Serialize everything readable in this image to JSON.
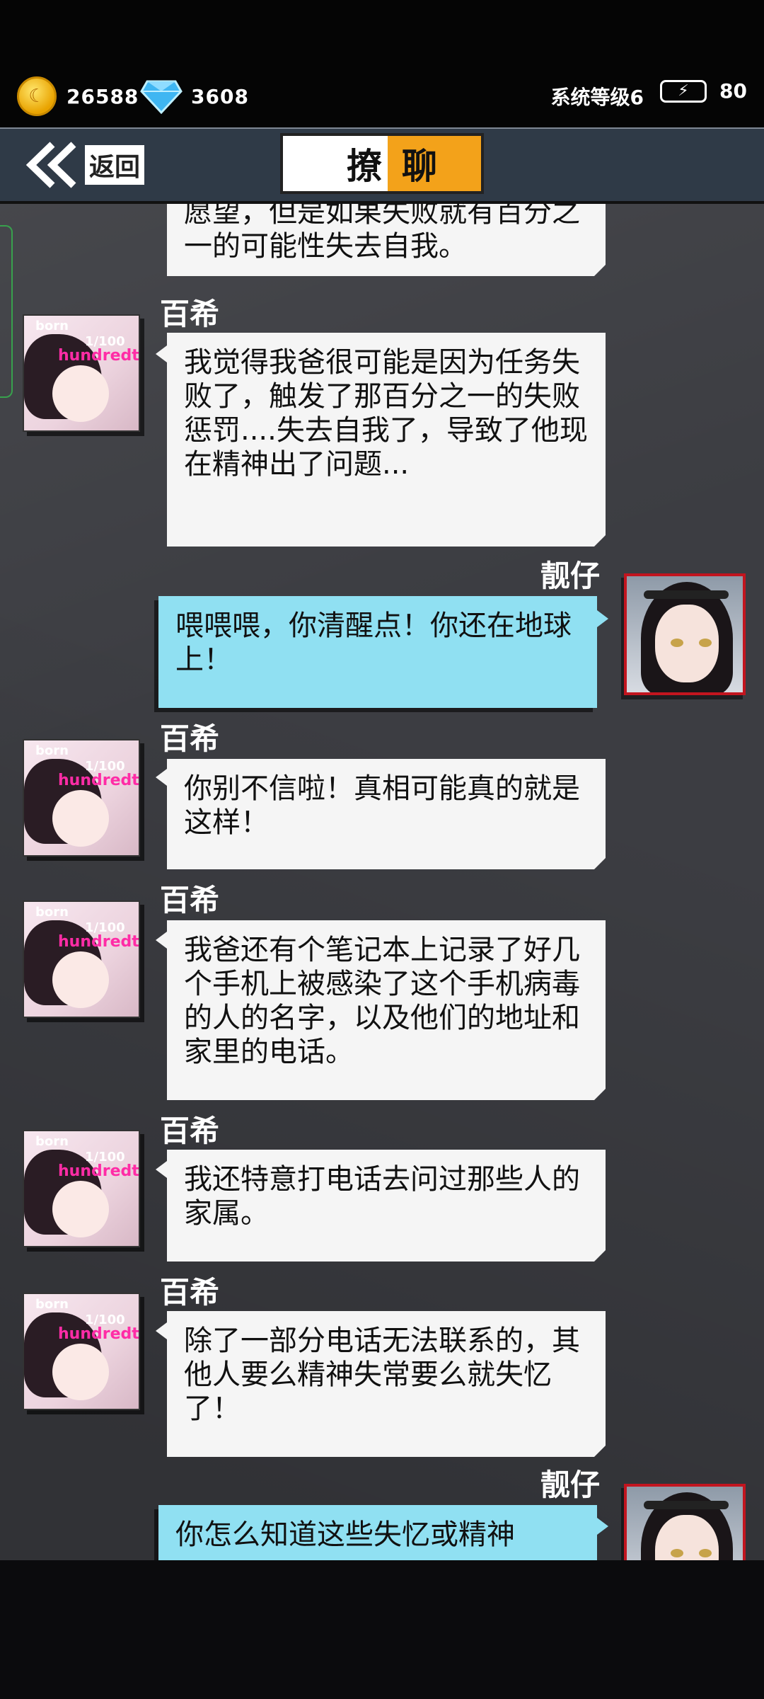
{
  "status": {
    "gold": "26588",
    "diamonds": "3608",
    "system_level": "系统等级6",
    "energy": "80",
    "coin_icon": "gold-coin-icon",
    "diamond_icon": "diamond-icon",
    "energy_icon": "lightning-battery-icon"
  },
  "header": {
    "back_label": "返回",
    "title_left": "撩",
    "title_right": "聊",
    "accent_color": "#f3a21a"
  },
  "messages": [
    {
      "side": "left",
      "sender": "",
      "text": "愿望，但是如果失败就有百分之一的可能性失去自我。"
    },
    {
      "side": "left",
      "sender": "百希",
      "text": "我觉得我爸很可能是因为任务失败了，触发了那百分之一的失败惩罚....失去自我了，导致了他现在精神出了问题..."
    },
    {
      "side": "right",
      "sender": "靓仔",
      "text": "喂喂喂，你清醒点！你还在地球上！"
    },
    {
      "side": "left",
      "sender": "百希",
      "text": "你别不信啦！真相可能真的就是这样！"
    },
    {
      "side": "left",
      "sender": "百希",
      "text": "我爸还有个笔记本上记录了好几个手机上被感染了这个手机病毒的人的名字，以及他们的地址和家里的电话。"
    },
    {
      "side": "left",
      "sender": "百希",
      "text": "我还特意打电话去问过那些人的家属。"
    },
    {
      "side": "left",
      "sender": "百希",
      "text": "除了一部分电话无法联系的，其他人要么精神失常要么就失忆了！"
    },
    {
      "side": "right",
      "sender": "靓仔",
      "text": "你怎么知道这些失忆或精神"
    }
  ],
  "avatars": {
    "left_tag": "hundredth",
    "left_t1": "born",
    "left_t2": "1/100"
  }
}
